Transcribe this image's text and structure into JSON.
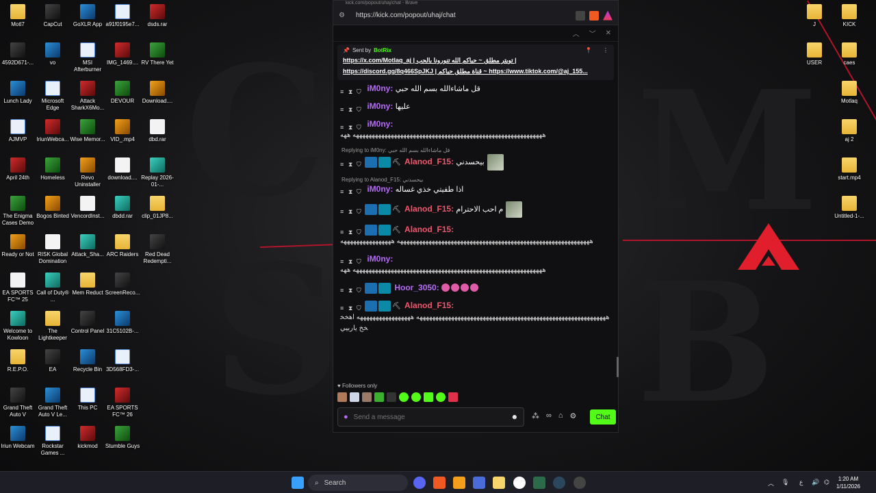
{
  "browser": {
    "title": "kick.com/popout/uhaj/chat - Brave",
    "url": "https://kick.com/popout/uhaj/chat"
  },
  "pinned": {
    "sent_by": "Sent by",
    "bot_name": "BotRix",
    "line1": "https://x.com/Motlaq_aj | تويتر مطلق ~ حياكم الله تنورونا بالحب |",
    "line2": "https://discord.gg/8q466SpJKJ | قناة مطلق حياكم ~ https://www.tiktok.com/@aj_155..."
  },
  "messages": [
    {
      "user": "iM0ny",
      "color": "#b46cf5",
      "text": "قل ماشاءالله بسم الله حبي",
      "subs": false
    },
    {
      "user": "iM0ny",
      "color": "#b46cf5",
      "text": "عليها",
      "subs": false
    },
    {
      "user": "iM0ny",
      "color": "#b46cf5",
      "text": "",
      "subs": false,
      "long": "ههههههههههههههههههههههههههههههههههههههههههههههههههههههههههههه ههه"
    },
    {
      "reply": "Replying to iM0ny: قل ماشاءالله بسم الله حبي",
      "user": "Alanod_F15",
      "color": "#f0566c",
      "text": "بيحسدني",
      "subs": true,
      "avatar": true
    },
    {
      "reply": "Replying to Alanod_F15: بيحسدني",
      "user": "iM0ny",
      "color": "#b46cf5",
      "text": "اذا طفيتي خذي غساله",
      "subs": false
    },
    {
      "user": "Alanod_F15",
      "color": "#f0566c",
      "text": "م احب الاحترام",
      "subs": true,
      "avatar": true
    },
    {
      "user": "Alanod_F15",
      "color": "#f0566c",
      "text": "",
      "subs": true,
      "long": "هههههههههههههههههههههههههههههههههههههههههههههههههههههههههههههه ههههههههههههههههه"
    },
    {
      "user": "iM0ny",
      "color": "#b46cf5",
      "text": "",
      "subs": false,
      "long": "ههههههههههههههههههههههههههههههههههههههههههههههههههههههههههههه ههه"
    },
    {
      "user": "Hoor_3050",
      "color": "#b46cf5",
      "text": "",
      "subs": true,
      "emotes": 4
    },
    {
      "user": "Alanod_F15",
      "color": "#f0566c",
      "text": "",
      "subs": true,
      "long": "ههههههههههههههههههههههههههههههههههههههههههههههههههههههههههههه هههههههههههههههههه اهخخخخ ياربيي"
    }
  ],
  "chat": {
    "followers_only": "Followers only",
    "placeholder": "Send a message",
    "send_label": "Chat"
  },
  "desktop_left": [
    [
      "Motl7",
      "CapCut",
      "GoXLR App",
      "a91f0195e7...",
      "dsds.rar"
    ],
    [
      "4592D671-...",
      "vo",
      "MSI Afterburner",
      "IMG_1469....",
      "RV There Yet"
    ],
    [
      "Lunch Lady",
      "Microsoft Edge",
      "Attack SharkX6Mo...",
      "DEVOUR",
      "Download...."
    ],
    [
      "AJMVP",
      "IriunWebca...",
      "Wise Memor...",
      "VID_.mp4",
      "dbd.rar"
    ],
    [
      "April 24th",
      "Homeless",
      "Revo Uninstaller",
      "download....",
      "Replay 2026-01-..."
    ],
    [
      "The Enigma Cases Demo",
      "Bogos Binted",
      "VencordInst...",
      "dbdd.rar",
      "clip_01JP8..."
    ],
    [
      "Ready or Not",
      "RISK Global Domination",
      "Attack_Sha...",
      "ARC Raiders",
      "Red Dead Redempti..."
    ],
    [
      "EA SPORTS FC™ 25",
      "Call of Duty® ...",
      "Mem Reduct",
      "ScreenReco...",
      ""
    ],
    [
      "Welcome to Kowloon",
      "The Lightkeeper",
      "Control Panel",
      "31C5102B-...",
      ""
    ],
    [
      "R.E.P.O.",
      "EA",
      "Recycle Bin",
      "3D568FD3-...",
      ""
    ],
    [
      "Grand Theft Auto V",
      "Grand Theft Auto V Le...",
      "This PC",
      "EA SPORTS FC™ 26",
      ""
    ],
    [
      "Iriun Webcam",
      "Rockstar Games ...",
      "kickmod",
      "Stumble Guys",
      ""
    ]
  ],
  "desktop_right": [
    [
      "J",
      "KICK"
    ],
    [
      "USER",
      "caes"
    ],
    [
      "",
      "Motlaq"
    ],
    [
      "",
      "aj 2"
    ],
    [
      "",
      "start.mp4"
    ],
    [
      "",
      "Untitled-1-..."
    ]
  ],
  "taskbar": {
    "search": "Search",
    "time": "1:20 AM",
    "date": "1/11/2026",
    "lang": "ع"
  }
}
